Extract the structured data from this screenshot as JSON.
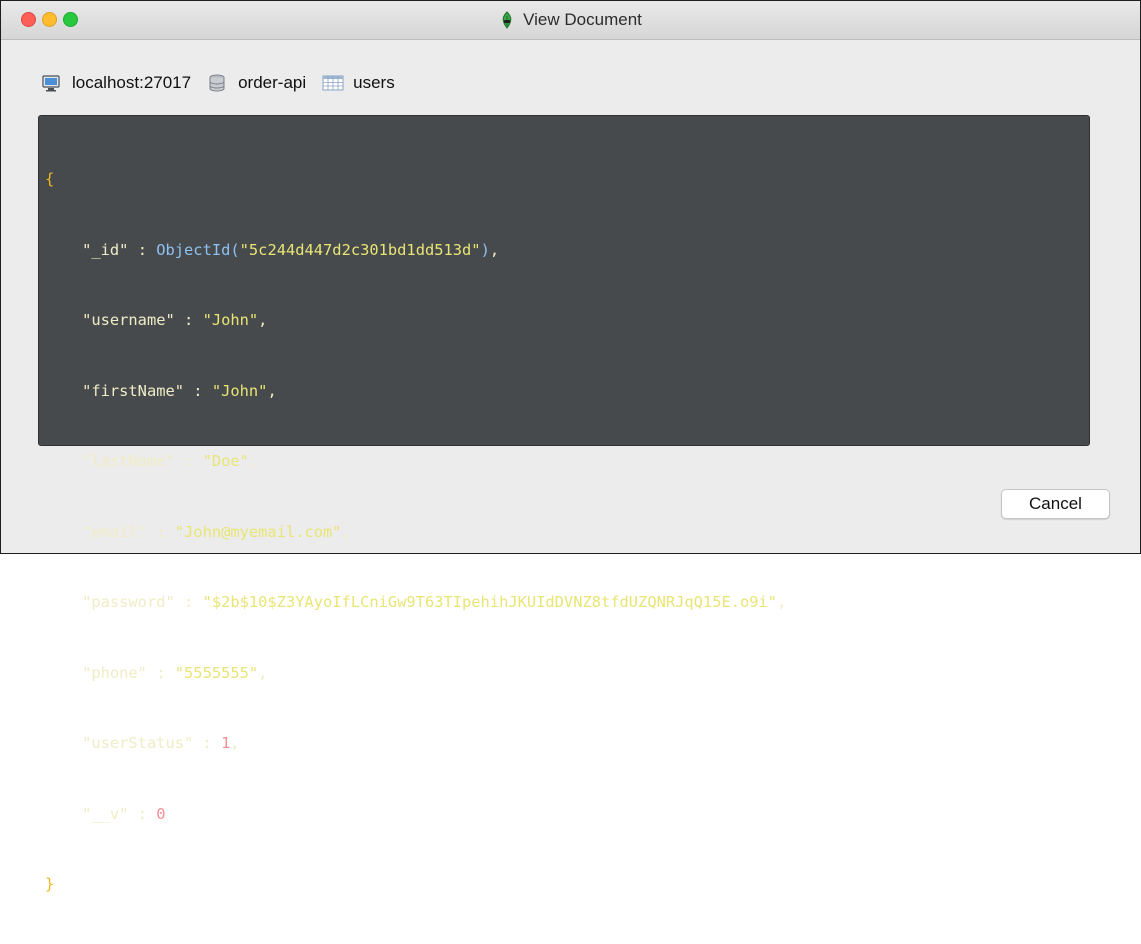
{
  "window": {
    "title": "View Document"
  },
  "breadcrumb": {
    "host": "localhost:27017",
    "database": "order-api",
    "collection": "users"
  },
  "document": {
    "open_brace": "{",
    "close_brace": "}",
    "fields": [
      {
        "key": "\"_id\"",
        "value_fn": "ObjectId(",
        "value": "\"5c244d447d2c301bd1dd513d\"",
        "value_fn_close": ")",
        "type": "objectid",
        "comma": ","
      },
      {
        "key": "\"username\"",
        "value": "\"John\"",
        "type": "string",
        "comma": ","
      },
      {
        "key": "\"firstName\"",
        "value": "\"John\"",
        "type": "string",
        "comma": ","
      },
      {
        "key": "\"lastName\"",
        "value": "\"Doe\"",
        "type": "string",
        "comma": ","
      },
      {
        "key": "\"email\"",
        "value": "\"John@myemail.com\"",
        "type": "string",
        "comma": ","
      },
      {
        "key": "\"password\"",
        "value": "\"$2b$10$Z3YAyoIfLCniGw9T63TIpehihJKUIdDVNZ8tfdUZQNRJqQ15E.o9i\"",
        "type": "string",
        "comma": ","
      },
      {
        "key": "\"phone\"",
        "value": "\"5555555\"",
        "type": "string",
        "comma": ","
      },
      {
        "key": "\"userStatus\"",
        "value": "1",
        "type": "number",
        "comma": ","
      },
      {
        "key": "\"__v\"",
        "value": "0",
        "type": "number",
        "comma": ""
      }
    ]
  },
  "footer": {
    "cancel_label": "Cancel"
  },
  "colors": {
    "panel_background": "#474a4c",
    "brace": "#f3b722",
    "key": "#f0ecc6",
    "string": "#e8e575",
    "number": "#f88f93",
    "function": "#8ec1f2"
  },
  "icons": {
    "title": "robo-3t-leaf-icon",
    "host": "computer-icon",
    "database": "database-icon",
    "collection": "table-icon"
  }
}
